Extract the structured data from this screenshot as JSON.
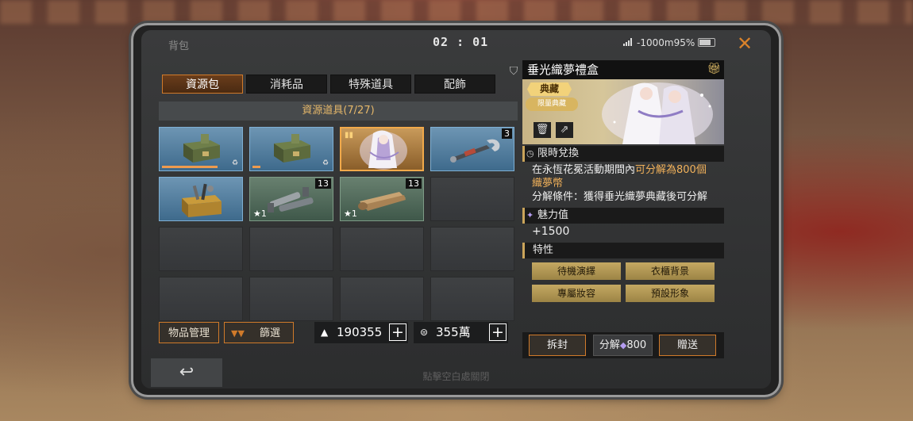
{
  "status": {
    "title": "背包",
    "clock": "02 : 01",
    "network": "-1000m",
    "battery": "95%"
  },
  "tabs": [
    {
      "label": "資源包",
      "active": true
    },
    {
      "label": "消耗品",
      "active": false
    },
    {
      "label": "特殊道具",
      "active": false
    },
    {
      "label": "配飾",
      "active": false
    }
  ],
  "section_title": "資源道具(7/27)",
  "items": [
    {
      "icon": "ammo-crate-icon",
      "rarity": "blue"
    },
    {
      "icon": "ammo-crate-icon",
      "rarity": "blue"
    },
    {
      "icon": "gift-box-portrait-icon",
      "rarity": "gold"
    },
    {
      "icon": "wrench-icon",
      "rarity": "blue",
      "count": "3"
    },
    {
      "icon": "toolbox-icon",
      "rarity": "blue"
    },
    {
      "icon": "metal-parts-icon",
      "rarity": "green",
      "count": "13",
      "star": "1"
    },
    {
      "icon": "cloth-roll-icon",
      "rarity": "green",
      "count": "13",
      "star": "1"
    }
  ],
  "buttons": {
    "manage": "物品管理",
    "filter": "篩選"
  },
  "currency": {
    "coins": "190355",
    "cash": "355萬"
  },
  "footer_hint": "點擊空白處關閉",
  "detail": {
    "name": "垂光織夢禮盒",
    "rarity_tag": "典藏",
    "badge_text": "限量典藏",
    "limited_title": "限時兌換",
    "desc_prefix": "在永恆花冕活動期間內",
    "desc_highlight": "可分解為800個",
    "desc_line2": "織夢幣",
    "desc_condition": "分解條件：獲得垂光織夢典藏後可分解",
    "charm_title": "魅力值",
    "charm_value": "+1500",
    "traits_title": "特性",
    "traits": [
      "待機演繹",
      "衣櫃背景",
      "專屬妝容",
      "預設形象"
    ],
    "actions": {
      "unseal": "拆封",
      "decompose_label": "分解",
      "decompose_value": "800",
      "gift": "贈送"
    }
  },
  "colors": {
    "accent": "#d07a2a",
    "highlight": "#f1b15a",
    "blue_rarity": "#5b87a8",
    "green_rarity": "#546e5c",
    "gold_rarity": "#c89a5a"
  }
}
